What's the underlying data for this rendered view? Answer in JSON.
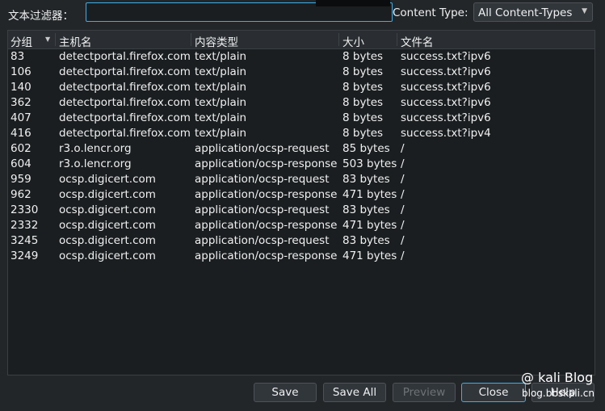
{
  "filter": {
    "label": "文本过滤器：",
    "value": ""
  },
  "content_type": {
    "label": "Content Type:",
    "selected": "All Content-Types"
  },
  "table": {
    "headers": [
      "分组",
      "主机名",
      "内容类型",
      "大小",
      "文件名"
    ],
    "rows": [
      [
        "83",
        "detectportal.firefox.com",
        "text/plain",
        "8 bytes",
        "success.txt?ipv6"
      ],
      [
        "106",
        "detectportal.firefox.com",
        "text/plain",
        "8 bytes",
        "success.txt?ipv6"
      ],
      [
        "140",
        "detectportal.firefox.com",
        "text/plain",
        "8 bytes",
        "success.txt?ipv6"
      ],
      [
        "362",
        "detectportal.firefox.com",
        "text/plain",
        "8 bytes",
        "success.txt?ipv6"
      ],
      [
        "407",
        "detectportal.firefox.com",
        "text/plain",
        "8 bytes",
        "success.txt?ipv6"
      ],
      [
        "416",
        "detectportal.firefox.com",
        "text/plain",
        "8 bytes",
        "success.txt?ipv4"
      ],
      [
        "602",
        "r3.o.lencr.org",
        "application/ocsp-request",
        "85 bytes",
        "/"
      ],
      [
        "604",
        "r3.o.lencr.org",
        "application/ocsp-response",
        "503 bytes",
        "/"
      ],
      [
        "959",
        "ocsp.digicert.com",
        "application/ocsp-request",
        "83 bytes",
        "/"
      ],
      [
        "962",
        "ocsp.digicert.com",
        "application/ocsp-response",
        "471 bytes",
        "/"
      ],
      [
        "2330",
        "ocsp.digicert.com",
        "application/ocsp-request",
        "83 bytes",
        "/"
      ],
      [
        "2332",
        "ocsp.digicert.com",
        "application/ocsp-response",
        "471 bytes",
        "/"
      ],
      [
        "3245",
        "ocsp.digicert.com",
        "application/ocsp-request",
        "83 bytes",
        "/"
      ],
      [
        "3249",
        "ocsp.digicert.com",
        "application/ocsp-response",
        "471 bytes",
        "/"
      ]
    ]
  },
  "buttons": {
    "save": "Save",
    "save_all": "Save All",
    "preview": "Preview",
    "close": "Close",
    "help": "Help"
  },
  "watermark": {
    "line1": "@ kali Blog",
    "line2": "blog.bbskali.cn"
  },
  "colors": {
    "accent": "#3daee9",
    "background": "#232629",
    "table_bg": "#1b1e20"
  }
}
